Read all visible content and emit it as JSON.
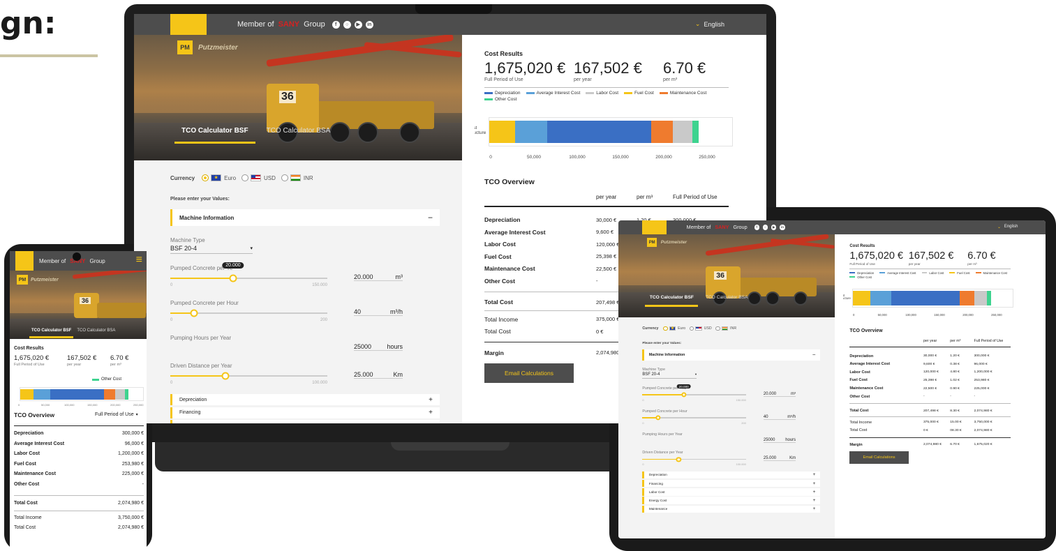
{
  "heading_fragment": "gn:",
  "brand": {
    "member_prefix": "Member of",
    "group_word": "Group",
    "parent_brand": "SANY",
    "company": "Putzmeister",
    "logo_glyph": "PM",
    "truck_number": "36"
  },
  "language": "English",
  "social_icons": [
    "facebook-icon",
    "instagram-icon",
    "youtube-icon",
    "linkedin-icon"
  ],
  "tabs": [
    "TCO Calculator BSF",
    "TCO Calculator BSA"
  ],
  "currency": {
    "label": "Currency",
    "options": [
      {
        "code": "Euro",
        "flag": "eu",
        "selected": true
      },
      {
        "code": "USD",
        "flag": "us",
        "selected": false
      },
      {
        "code": "INR",
        "flag": "in",
        "selected": false
      }
    ]
  },
  "form": {
    "prompt": "Please enter your Values:",
    "machine_section": "Machine Information",
    "machine_type_label": "Machine Type",
    "machine_type_value": "BSF 20-4",
    "sliders": [
      {
        "label": "Pumped Concrete per Year",
        "label_cut_laptop": "Pumped Concrete per Ye",
        "bubble": "20.000",
        "min": "0",
        "max": "150.000",
        "value_text": "20.000",
        "unit": "m³",
        "fraction": 0.4
      },
      {
        "label": "Pumped Concrete per Hour",
        "min": "0",
        "max": "200",
        "value_text": "40",
        "unit": "m³/h",
        "fraction": 0.15
      },
      {
        "label": "Pumping Hours per Year",
        "value_text": "25000",
        "unit": "hours"
      },
      {
        "label": "Driven Distance per Year",
        "min": "0",
        "max": "100.000",
        "value_text": "25.000",
        "unit": "Km",
        "fraction": 0.35
      }
    ],
    "collapsed_sections": [
      "Depreciation",
      "Financing",
      "Labor Cost",
      "Energy Cost",
      "Maintenance"
    ]
  },
  "results": {
    "title": "Cost Results",
    "total_period": "1,675,020 €",
    "total_period_label": "Full Period of Use",
    "per_year": "167,502 €",
    "per_year_label": "per year",
    "per_m3": "6.70 €",
    "per_m3_label": "per m³"
  },
  "chart_data": {
    "type": "bar",
    "orientation": "horizontal-stacked",
    "category": "Cost Structure",
    "category_lines": [
      "Cost",
      "Structure"
    ],
    "series": [
      {
        "name": "Depreciation",
        "value": 30000,
        "color": "#f5c518"
      },
      {
        "name": "Average Interest Cost",
        "value": 37000,
        "color": "#5aa0d8"
      },
      {
        "name": "Labor Cost",
        "value": 120000,
        "color": "#3a6fc4"
      },
      {
        "name": "Fuel Cost",
        "value": 25398,
        "color": "#ef7b2e"
      },
      {
        "name": "Maintenance Cost",
        "value": 22500,
        "color": "#c9c9c9"
      },
      {
        "name": "Other Cost",
        "value": 7000,
        "color": "#3ed38f"
      }
    ],
    "legend_order": [
      "Depreciation",
      "Average Interest Cost",
      "Labor Cost",
      "Fuel Cost",
      "Maintenance Cost",
      "Other Cost"
    ],
    "legend_colors": [
      "#3a6fc4",
      "#5aa0d8",
      "#c9c9c9",
      "#f5c518",
      "#ef7b2e",
      "#3ed38f"
    ],
    "xlim": [
      0,
      250000
    ],
    "xticks": [
      "0",
      "50,000",
      "100,000",
      "150,000",
      "200,000",
      "250,000"
    ]
  },
  "tco": {
    "title": "TCO Overview",
    "columns": [
      "per year",
      "per m³",
      "Full Period of Use"
    ],
    "rows": [
      {
        "label": "Depreciation",
        "year": "30,000 €",
        "m3": "1.20 €",
        "full": "300,000 €"
      },
      {
        "label": "Average Interest Cost",
        "year": "9,600 €",
        "m3": "0.38 €",
        "full": "96,000 €"
      },
      {
        "label": "Labor Cost",
        "year": "120,000 €",
        "m3": "4.80 €",
        "full": "1,200,000 €"
      },
      {
        "label": "Fuel Cost",
        "year": "25,398 €",
        "m3": "1.02 €",
        "full": "253,980 €"
      },
      {
        "label": "Maintenance Cost",
        "year": "22,500 €",
        "m3": "0.90 €",
        "full": "225,000 €"
      },
      {
        "label": "Other Cost",
        "year": "-",
        "m3": "-",
        "full": "-"
      }
    ],
    "total": {
      "label": "Total Cost",
      "year": "207,498 €",
      "m3": "8.30 €",
      "full": "2,074,980 €"
    },
    "income": {
      "label": "Total Income",
      "year": "375,000 €",
      "m3": "15.00 €",
      "full": "3,750,000 €"
    },
    "total2": {
      "label": "Total Cost",
      "year": "0 €",
      "m3": "08.30 €",
      "full": "2,074,980 €"
    },
    "margin": {
      "label": "Margin",
      "year": "2,074,980 €",
      "m3": "6.70 €",
      "full": "1,675,020 €"
    },
    "email_button": "Email Calculations"
  },
  "mobile": {
    "legend_label": "Other Cost",
    "period_selector": "Full Period of Use",
    "ticks": [
      "0",
      "50,000",
      "100,000",
      "150,000",
      "200,000",
      "250,000"
    ],
    "rows": [
      {
        "label": "Depreciation",
        "full": "300,000 €"
      },
      {
        "label": "Average Interest Cost",
        "full": "96,000 €"
      },
      {
        "label": "Labor Cost",
        "full": "1,200,000 €"
      },
      {
        "label": "Fuel Cost",
        "full": "253,980 €"
      },
      {
        "label": "Maintenance Cost",
        "full": "225,000 €"
      },
      {
        "label": "Other Cost",
        "full": "-"
      }
    ],
    "total": {
      "label": "Total Cost",
      "full": "2,074,980 €"
    },
    "income": {
      "label": "Total Income",
      "full": "3,750,000 €"
    },
    "total2": {
      "label": "Total Cost",
      "full": "2,074,980 €"
    }
  }
}
